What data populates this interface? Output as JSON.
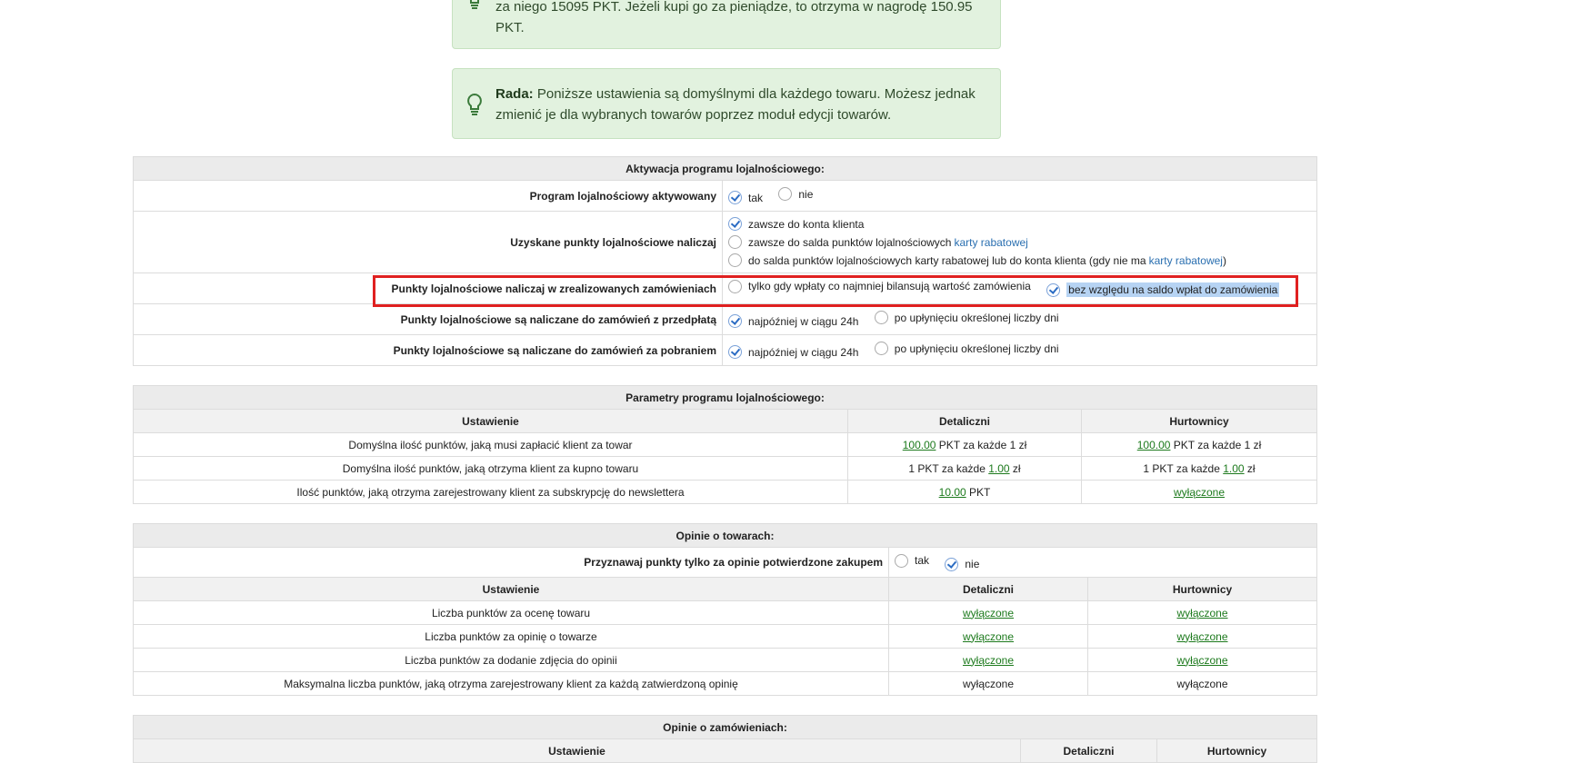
{
  "tips": [
    {
      "lead": "",
      "text": "za niego 15095 PKT. Jeżeli kupi go za pieniądze, to otrzyma w nagrodę 150.95 PKT."
    },
    {
      "lead": "Rada:",
      "text": " Poniższe ustawienia są domyślnymi dla każdego towaru. Możesz jednak zmienić je dla wybranych towarów poprzez moduł edycji towarów."
    }
  ],
  "activation": {
    "header": "Aktywacja programu lojalnościowego:",
    "rows": [
      {
        "label": "Program lojalnościowy aktywowany",
        "options": [
          "tak",
          "nie"
        ],
        "selected": 0
      },
      {
        "label": "Uzyskane punkty lojalnościowe naliczaj",
        "options": [
          {
            "text": "zawsze do konta klienta"
          },
          {
            "text": "zawsze do salda punktów lojalnościowych ",
            "link": "karty rabatowej"
          },
          {
            "text": "do salda punktów lojalnościowych karty rabatowej lub do konta klienta (gdy nie ma ",
            "link": "karty rabatowej",
            "after": ")"
          }
        ],
        "selected": 0
      },
      {
        "label": "Punkty lojalnościowe naliczaj w zrealizowanych zamówieniach",
        "options": [
          "tylko gdy wpłaty co najmniej bilansują wartość zamówienia",
          "bez względu na saldo wpłat do zamówienia"
        ],
        "selected": 1
      },
      {
        "label": "Punkty lojalnościowe są naliczane do zamówień z przedpłatą",
        "options": [
          "najpóźniej w ciągu 24h",
          "po upłynięciu określonej liczby dni"
        ],
        "selected": 0
      },
      {
        "label": "Punkty lojalnościowe są naliczane do zamówień za pobraniem",
        "options": [
          "najpóźniej w ciągu 24h",
          "po upłynięciu określonej liczby dni"
        ],
        "selected": 0
      }
    ]
  },
  "params": {
    "header": "Parametry programu lojalnościowego:",
    "columns": [
      "Ustawienie",
      "Detaliczni",
      "Hurtownicy"
    ],
    "rows": [
      {
        "name": "Domyślna ilość punktów, jaką musi zapłacić klient za towar",
        "det": {
          "pre": "",
          "link": "100.00",
          "post": " PKT za każde 1 zł"
        },
        "hurt": {
          "pre": "",
          "link": "100.00",
          "post": " PKT za każde 1 zł"
        }
      },
      {
        "name": "Domyślna ilość punktów, jaką otrzyma klient za kupno towaru",
        "det": {
          "pre": "1 PKT za każde ",
          "link": "1.00",
          "post": " zł"
        },
        "hurt": {
          "pre": "1 PKT za każde ",
          "link": "1.00",
          "post": " zł"
        }
      },
      {
        "name": "Ilość punktów, jaką otrzyma zarejestrowany klient za subskrypcję do newslettera",
        "det": {
          "pre": "",
          "link": "10.00",
          "post": " PKT"
        },
        "hurt": {
          "pre": "",
          "link": "wyłączone",
          "post": ""
        }
      }
    ]
  },
  "opinions": {
    "header": "Opinie o towarach:",
    "confirm_label": "Przyznawaj punkty tylko za opinie potwierdzone zakupem",
    "confirm_options": [
      "tak",
      "nie"
    ],
    "confirm_selected": 1,
    "columns": [
      "Ustawienie",
      "Detaliczni",
      "Hurtownicy"
    ],
    "rows": [
      {
        "name": "Liczba punktów za ocenę towaru",
        "det": "wyłączone",
        "hurt": "wyłączone",
        "link": true
      },
      {
        "name": "Liczba punktów za opinię o towarze",
        "det": "wyłączone",
        "hurt": "wyłączone",
        "link": true
      },
      {
        "name": "Liczba punktów za dodanie zdjęcia do opinii",
        "det": "wyłączone",
        "hurt": "wyłączone",
        "link": true
      },
      {
        "name": "Maksymalna liczba punktów, jaką otrzyma zarejestrowany klient za każdą zatwierdzoną opinię",
        "det": "wyłączone",
        "hurt": "wyłączone",
        "link": false
      }
    ]
  },
  "order_opinions": {
    "header": "Opinie o zamówieniach:",
    "columns": [
      "Ustawienie",
      "Detaliczni",
      "Hurtownicy"
    ]
  },
  "colors": {
    "tip_bg": "#e2f2df",
    "link_green": "#1d7a1d",
    "link_blue": "#2a6fb0",
    "highlight": "#e02020"
  }
}
